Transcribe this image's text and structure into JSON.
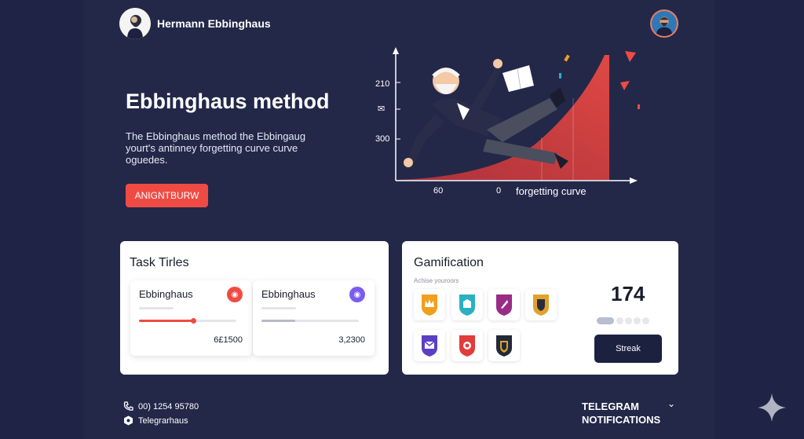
{
  "header": {
    "brand_name": "Hermann Ebbinghaus"
  },
  "hero": {
    "title": "Ebbinghaus method",
    "description": "The Ebbinghaus method the Ebbingaug yourt's antinney forgetting curve curve oguedes.",
    "cta_label": "ANIGNTBURW"
  },
  "hero_chart": {
    "y_labels": [
      "210",
      "300"
    ],
    "x_labels": [
      "60",
      "0"
    ],
    "x_axis_label": "forgetting curve"
  },
  "tasks_card": {
    "title": "Task Tirles",
    "tasks": [
      {
        "name": "Ebbinghaus",
        "value": "6£1500",
        "progress": 0.55,
        "color": "#ef4b43"
      },
      {
        "name": "Ebbinghaus",
        "value": "3,2300",
        "progress": 0.35,
        "color": "#8a8e9c"
      }
    ]
  },
  "gamification_card": {
    "title": "Gamification",
    "subtitle": "Achise youroors",
    "streak_count": "174",
    "streak_button": "Streak",
    "badges": [
      {
        "icon": "crown-badge-icon",
        "color": "#f0a01e"
      },
      {
        "icon": "castle-badge-icon",
        "color": "#2ab0c2"
      },
      {
        "icon": "rocket-badge-icon",
        "color": "#9a2b86"
      },
      {
        "icon": "shield-badge-icon",
        "color": "#e0a22a"
      },
      {
        "icon": "mail-badge-icon",
        "color": "#5b3fc4"
      },
      {
        "icon": "fire-badge-icon",
        "color": "#e23b3b"
      },
      {
        "icon": "lock-badge-icon",
        "color": "#222a3a"
      }
    ]
  },
  "footer": {
    "phone": "00) 1254 95780",
    "telegram_handle": "Telegrarhaus",
    "notify_line1": "TELEGRAM",
    "notify_line2": "NOTIFICATIONS"
  },
  "colors": {
    "background": "#232849",
    "accent": "#ef4b43",
    "dark_button": "#1c2140"
  }
}
